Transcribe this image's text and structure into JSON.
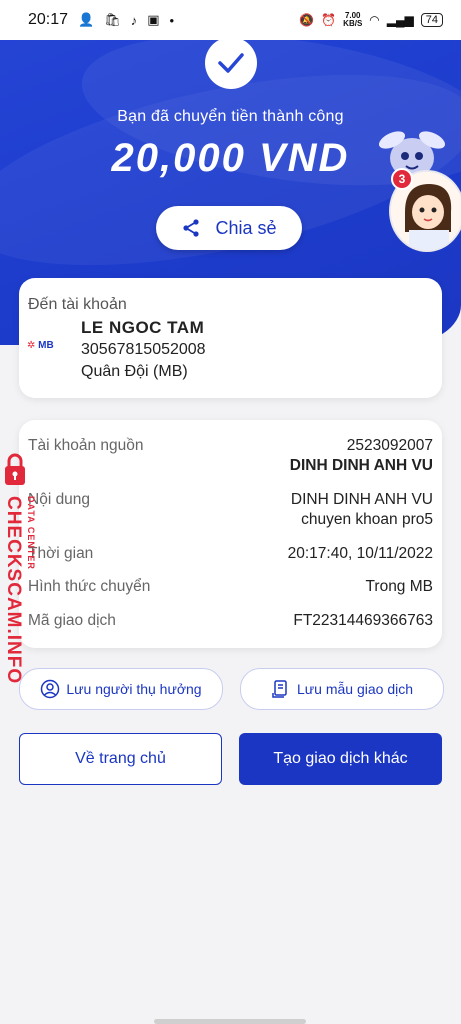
{
  "status_bar": {
    "time": "20:17",
    "speed_value": "7.00",
    "speed_unit": "KB/S",
    "battery": "74"
  },
  "hero": {
    "success_message": "Bạn đã chuyển tiền thành công",
    "amount": "20,000 VND",
    "share_label": "Chia sẻ",
    "chat_badge_count": "3"
  },
  "destination": {
    "label": "Đến tài khoản",
    "bank_logo_text": "MB",
    "name": "LE NGOC TAM",
    "account_number": "30567815052008",
    "bank_name": "Quân Đội (MB)"
  },
  "details": [
    {
      "label": "Tài khoản nguồn",
      "value": "2523092007",
      "value2": "DINH DINH ANH VU"
    },
    {
      "label": "Nội dung",
      "value": "DINH DINH ANH VU",
      "value2": "chuyen khoan pro5"
    },
    {
      "label": "Thời gian",
      "value": "20:17:40, 10/11/2022"
    },
    {
      "label": "Hình thức chuyển",
      "value": "Trong MB"
    },
    {
      "label": "Mã giao dịch",
      "value": "FT22314469366763"
    }
  ],
  "actions": {
    "save_beneficiary": "Lưu người thụ hưởng",
    "save_template": "Lưu mẫu giao dịch",
    "home": "Về trang chủ",
    "new_transaction": "Tạo giao dịch khác"
  },
  "watermark": {
    "main": "CHECKSCAM.INFO",
    "sub": "DATA CENTER"
  },
  "colors": {
    "primary": "#1b36c2",
    "hero_bg": "#2746d6",
    "watermark_red": "#e2293b"
  }
}
